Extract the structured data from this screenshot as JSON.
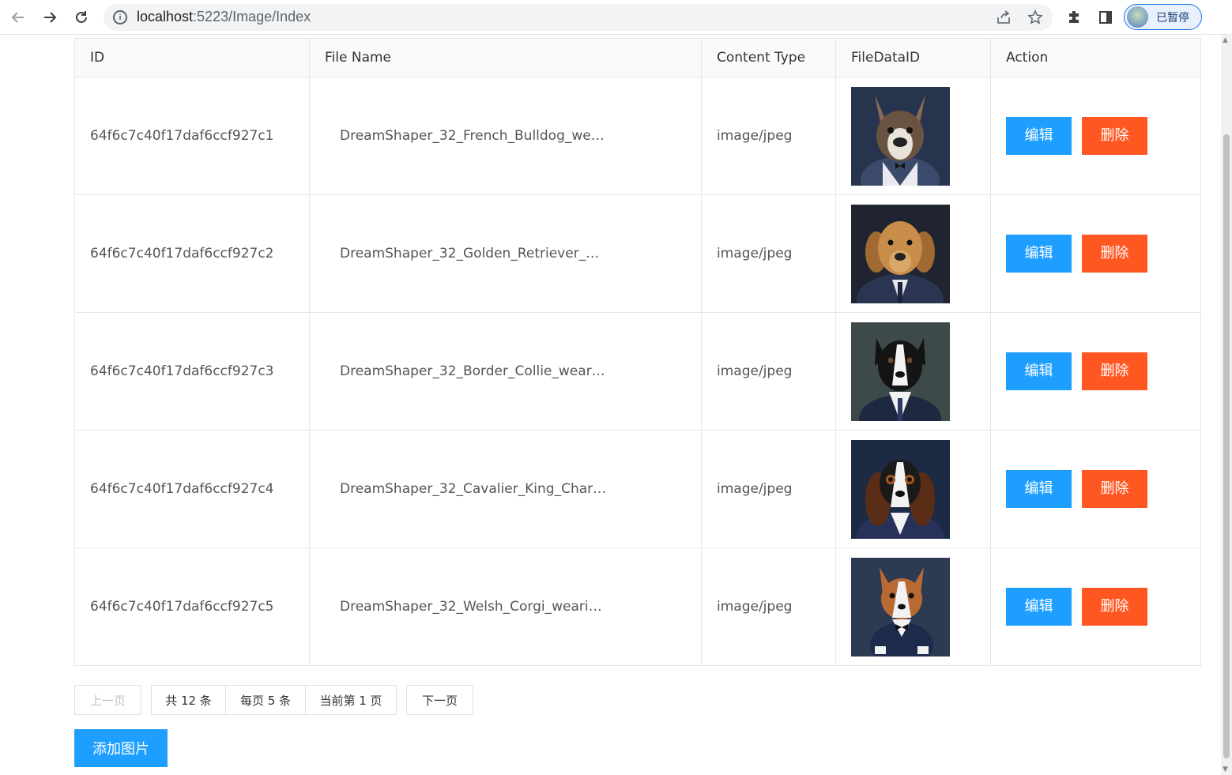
{
  "browser": {
    "url_host": "localhost",
    "url_path": ":5223/Image/Index",
    "profile_label": "已暂停"
  },
  "table": {
    "columns": [
      "ID",
      "File Name",
      "Content Type",
      "FileDataID",
      "Action"
    ],
    "rows": [
      {
        "id": "64f6c7c40f17daf6ccf927c1",
        "file_name": "DreamShaper_32_French_Bulldog_wear…",
        "content_type": "image/jpeg",
        "image": "french-bulldog-in-suit"
      },
      {
        "id": "64f6c7c40f17daf6ccf927c2",
        "file_name": "DreamShaper_32_Golden_Retriever_we…",
        "content_type": "image/jpeg",
        "image": "golden-retriever-in-suit"
      },
      {
        "id": "64f6c7c40f17daf6ccf927c3",
        "file_name": "DreamShaper_32_Border_Collie_wearin…",
        "content_type": "image/jpeg",
        "image": "border-collie-in-suit"
      },
      {
        "id": "64f6c7c40f17daf6ccf927c4",
        "file_name": "DreamShaper_32_Cavalier_King_Charle…",
        "content_type": "image/jpeg",
        "image": "cavalier-king-charles-in-suit"
      },
      {
        "id": "64f6c7c40f17daf6ccf927c5",
        "file_name": "DreamShaper_32_Welsh_Corgi_wearing…",
        "content_type": "image/jpeg",
        "image": "welsh-corgi-in-suit"
      }
    ],
    "edit_label": "编辑",
    "delete_label": "删除"
  },
  "pager": {
    "prev": "上一页",
    "total": "共 12 条",
    "per_page": "每页 5 条",
    "current": "当前第 1 页",
    "next": "下一页"
  },
  "add_button": "添加图片",
  "colors": {
    "primary": "#1e9fff",
    "danger": "#ff5722"
  }
}
